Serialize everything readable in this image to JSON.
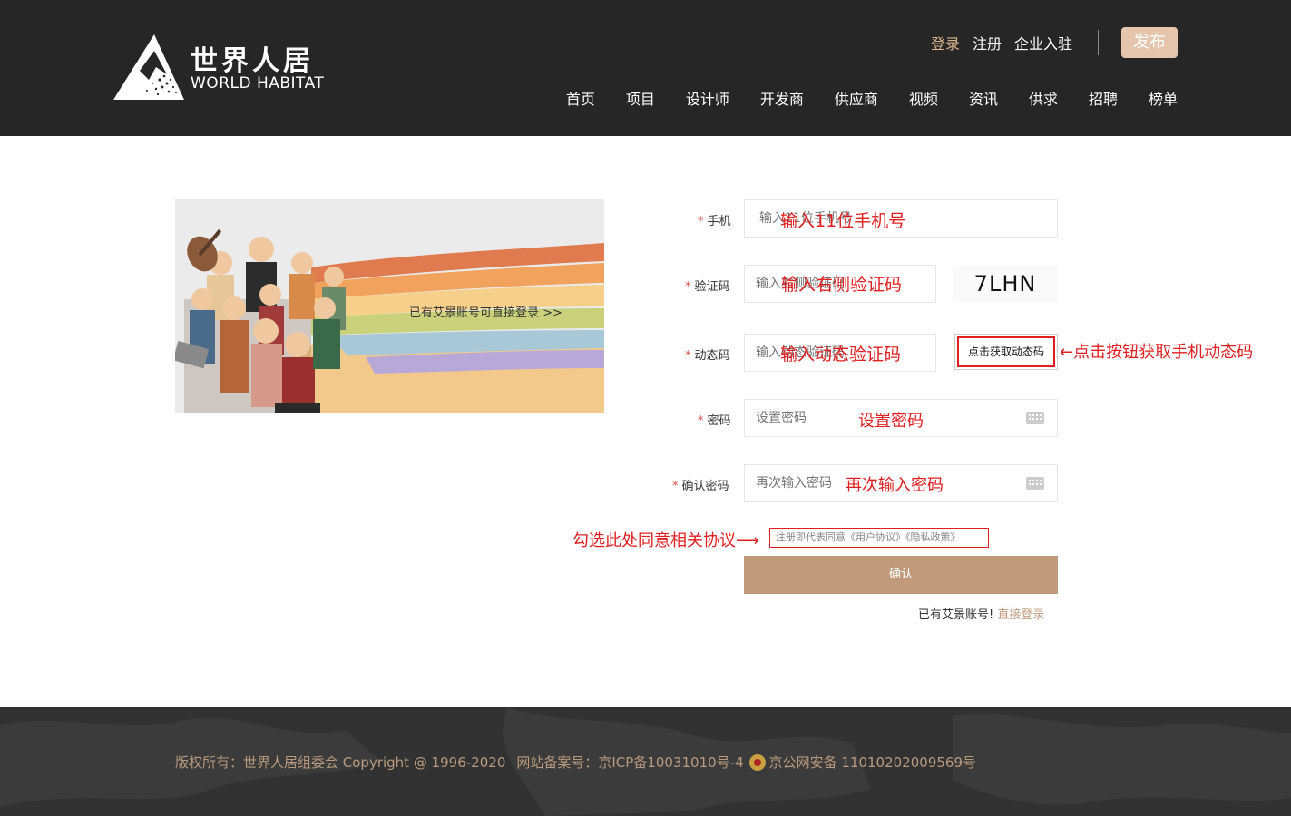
{
  "header": {
    "logo_cn": "世界人居",
    "logo_en": "WORLD HABITAT",
    "top_links": [
      "登录",
      "注册",
      "企业入驻"
    ],
    "publish_label": "发布",
    "nav": [
      "首页",
      "项目",
      "设计师",
      "开发商",
      "供应商",
      "视频",
      "资讯",
      "供求",
      "招聘",
      "榜单"
    ]
  },
  "banner": {
    "link_text": "已有艾景账号可直接登录 >>"
  },
  "form": {
    "phone": {
      "label": "手机",
      "placeholder": "输入11位手机号"
    },
    "captcha": {
      "label": "验证码",
      "placeholder": "输入右侧验证码",
      "code": "7LHN"
    },
    "sms": {
      "label": "动态码",
      "placeholder": "输入动态验证码",
      "button": "点击获取动态码"
    },
    "password": {
      "label": "密码",
      "placeholder": "设置密码"
    },
    "confirm_password": {
      "label": "确认密码",
      "placeholder": "再次输入密码"
    },
    "required_mark": "*",
    "agreement": "注册即代表同意《用户协议》《隐私政策》",
    "submit": "确认",
    "already_text": "已有艾景账号!",
    "login_link": "直接登录"
  },
  "annotations": {
    "sms_hint": "←点击按钮获取手机动态码",
    "agree_hint": "勾选此处同意相关协议⟶"
  },
  "footer": {
    "copyright": "版权所有：世界人居组委会 Copyright @ 1996-2020",
    "icp": "网站备案号：京ICP备10031010号-4",
    "police": "京公网安备 11010202009569号"
  },
  "colors": {
    "header_bg": "#262626",
    "accent": "#c19a7c",
    "publish_btn": "#e5c6ad",
    "annotation": "#e02020",
    "footer_bg": "#323232"
  }
}
